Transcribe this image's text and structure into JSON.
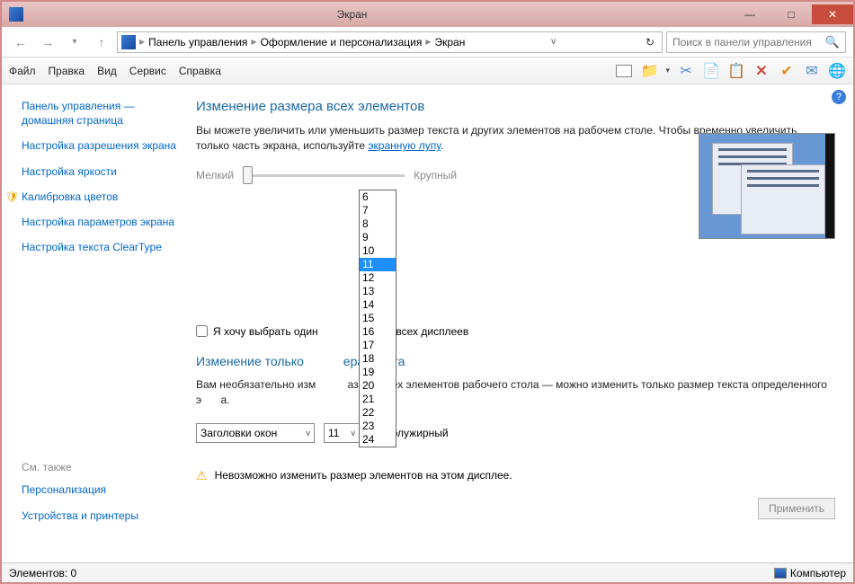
{
  "window": {
    "title": "Экран",
    "min": "—",
    "max": "□",
    "close": "✕"
  },
  "nav": {
    "back": "←",
    "fwd": "→",
    "up": "↑",
    "refresh": "↻"
  },
  "breadcrumb": {
    "item1": "Панель управления",
    "item2": "Оформление и персонализация",
    "item3": "Экран"
  },
  "search": {
    "placeholder": "Поиск в панели управления"
  },
  "menu": {
    "file": "Файл",
    "edit": "Правка",
    "view": "Вид",
    "service": "Сервис",
    "help": "Справка"
  },
  "sidebar": {
    "home": "Панель управления — домашняя страница",
    "resolution": "Настройка разрешения экрана",
    "brightness": "Настройка яркости",
    "calib": "Калибровка цветов",
    "params": "Настройка параметров экрана",
    "cleartype": "Настройка текста ClearType",
    "seealso": "См. также",
    "personalization": "Персонализация",
    "devices": "Устройства и принтеры"
  },
  "main": {
    "h1": "Изменение размера всех элементов",
    "p1a": "Вы можете увеличить или уменьшить размер текста и других элементов на рабочем столе. Чтобы временно увеличить только часть экрана, используйте ",
    "p1link": "экранную лупу",
    "p1b": ".",
    "slider_small": "Мелкий",
    "slider_large": "Крупный",
    "checkbox1": "Я хочу выбрать один",
    "checkbox1b": "аб для всех дисплеев",
    "h2a": "Изменение только",
    "h2b": "ера текста",
    "p2a": "Вам необязательно изм",
    "p2b": "азмер всех элементов рабочего стола — можно изменить только размер текста определенного э",
    "p2c": "а.",
    "select_item": "Заголовки окон",
    "select_size": "11",
    "bold_label": "Полужирный",
    "warning": "Невозможно изменить размер элементов на этом дисплее.",
    "apply": "Применить"
  },
  "dropdown": {
    "options": [
      "6",
      "7",
      "8",
      "9",
      "10",
      "11",
      "12",
      "13",
      "14",
      "15",
      "16",
      "17",
      "18",
      "19",
      "20",
      "21",
      "22",
      "23",
      "24"
    ],
    "selected": "11"
  },
  "status": {
    "elements": "Элементов: 0",
    "location": "Компьютер"
  },
  "help": "?"
}
